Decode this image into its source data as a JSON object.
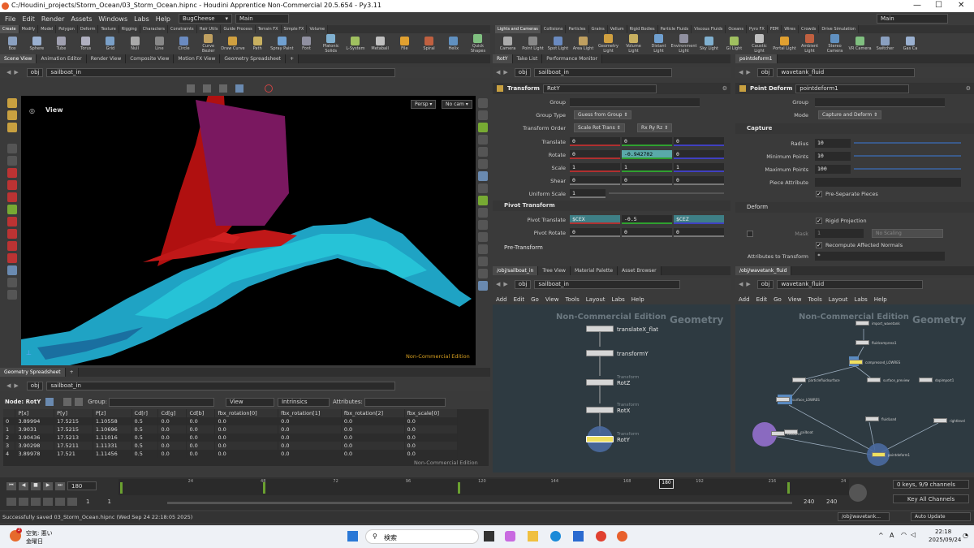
{
  "window": {
    "title": "C:/Houdini_projects/Storm_Ocean/03_Storm_Ocean.hipnc - Houdini Apprentice Non-Commercial 20.5.654 - Py3.11",
    "minimize": "—",
    "maximize": "☐",
    "close": "✕"
  },
  "menu": {
    "items": [
      "File",
      "Edit",
      "Render",
      "Assets",
      "Windows",
      "Labs",
      "Help"
    ],
    "desktop": "BugCheese",
    "context": "Main",
    "right_desktop": "Main"
  },
  "shelf_left": {
    "tabs": [
      "Create",
      "Modify",
      "Model",
      "Polygon",
      "Deform",
      "Texture",
      "Rigging",
      "Characters",
      "Constraints",
      "Hair Utils",
      "Guide Process",
      "Terrain FX",
      "Simple FX",
      "Volume"
    ],
    "tools": [
      "Box",
      "Sphere",
      "Tube",
      "Torus",
      "Grid",
      "Null",
      "Line",
      "Circle",
      "Curve Bezier",
      "Draw Curve",
      "Path",
      "Spray Paint",
      "Font",
      "Platonic Solids",
      "L-System",
      "Metaball",
      "File",
      "Spiral",
      "Helix",
      "Quick Shapes"
    ]
  },
  "shelf_right": {
    "tabs": [
      "Lights and Cameras",
      "Collisions",
      "Particles",
      "Grains",
      "Vellum",
      "Rigid Bodies",
      "Particle Fluids",
      "Viscous Fluids",
      "Oceans",
      "Pyro FX",
      "FEM",
      "Wires",
      "Crowds",
      "Drive Simulation"
    ],
    "tools": [
      "Camera",
      "Point Light",
      "Spot Light",
      "Area Light",
      "Geometry Light",
      "Volume Light",
      "Distant Light",
      "Environment Light",
      "Sky Light",
      "GI Light",
      "Caustic Light",
      "Portal Light",
      "Ambient Light",
      "Stereo Camera",
      "VR Camera",
      "Switcher",
      "Gas Ca"
    ]
  },
  "viewer": {
    "tabs": [
      "Scene View",
      "Animation Editor",
      "Render View",
      "Composite View",
      "Motion FX View",
      "Geometry Spreadsheet"
    ],
    "net": "obj",
    "node": "sailboat_in",
    "label": "View",
    "persp": "Persp ▾",
    "cam": "No cam ▾",
    "watermark": "Non-Commercial Edition"
  },
  "parms": {
    "tabs": [
      "RotY",
      "Take List",
      "Performance Monitor"
    ],
    "net": "obj",
    "node": "sailboat_in",
    "op_type": "Transform",
    "op_name": "RotY",
    "group_label": "Group",
    "group_type_label": "Group Type",
    "group_type": "Guess from Group",
    "order_label": "Transform Order",
    "order": "Scale Rot Trans",
    "rot_order": "Rx Ry Rz",
    "translate_label": "Translate",
    "translate": [
      "0",
      "0",
      "0"
    ],
    "rotate_label": "Rotate",
    "rotate": [
      "0",
      "-0.942702",
      "0"
    ],
    "scale_label": "Scale",
    "scale": [
      "1",
      "1",
      "1"
    ],
    "shear_label": "Shear",
    "shear": [
      "0",
      "0",
      "0"
    ],
    "uscale_label": "Uniform Scale",
    "uscale": "1",
    "pivot_section": "Pivot Transform",
    "pivot_t_label": "Pivot Translate",
    "pivot_t": [
      "$CEX",
      "-0.5",
      "$CEZ"
    ],
    "pivot_r_label": "Pivot Rotate",
    "pivot_r": [
      "0",
      "0",
      "0"
    ],
    "pre_section": "Pre-Transform"
  },
  "parms2": {
    "tab": "pointdeform1",
    "net": "obj",
    "node": "wavetank_fluid",
    "op_type": "Point Deform",
    "op_name": "pointdeform1",
    "group_label": "Group",
    "mode_label": "Mode",
    "mode": "Capture and Deform",
    "capture_section": "Capture",
    "radius_label": "Radius",
    "radius": "10",
    "minpts_label": "Minimum Points",
    "minpts": "10",
    "maxpts_label": "Maximum Points",
    "maxpts": "100",
    "piece_label": "Piece Attribute",
    "presep": "Pre-Separate Pieces",
    "deform_section": "Deform",
    "rigid": "Rigid Projection",
    "mask_label": "Mask",
    "mask": "1",
    "noscale": "No Scaling",
    "recompute": "Recompute Affected Normals",
    "attrs_label": "Attributes to Transform",
    "attrs": "*"
  },
  "spreadsheet": {
    "tab": "Geometry Spreadsheet",
    "net": "obj",
    "node": "sailboat_in",
    "node_label": "Node: RotY",
    "group_label": "Group:",
    "view": "View",
    "intrinsics": "Intrinsics",
    "attributes": "Attributes:",
    "columns": [
      "",
      "P[x]",
      "P[y]",
      "P[z]",
      "Cd[r]",
      "Cd[g]",
      "Cd[b]",
      "fbx_rotation[0]",
      "fbx_rotation[1]",
      "fbx_rotation[2]",
      "fbx_scale[0]"
    ],
    "rows": [
      [
        "0",
        "3.89994",
        "17.5215",
        "1.10558",
        "0.5",
        "0.0",
        "0.0",
        "0.0",
        "0.0",
        "0.0",
        "0.0"
      ],
      [
        "1",
        "3.9031",
        "17.5215",
        "1.10696",
        "0.5",
        "0.0",
        "0.0",
        "0.0",
        "0.0",
        "0.0",
        "0.0"
      ],
      [
        "2",
        "3.90436",
        "17.5213",
        "1.11016",
        "0.5",
        "0.0",
        "0.0",
        "0.0",
        "0.0",
        "0.0",
        "0.0"
      ],
      [
        "3",
        "3.90298",
        "17.5211",
        "1.11331",
        "0.5",
        "0.0",
        "0.0",
        "0.0",
        "0.0",
        "0.0",
        "0.0"
      ],
      [
        "4",
        "3.89978",
        "17.521",
        "1.11456",
        "0.5",
        "0.0",
        "0.0",
        "0.0",
        "0.0",
        "0.0",
        "0.0"
      ]
    ],
    "watermark": "Non-Commercial Edition"
  },
  "net1": {
    "tabs": [
      "/obj/sailboat_in",
      "Tree View",
      "Material Palette",
      "Asset Browser"
    ],
    "net": "obj",
    "node": "sailboat_in",
    "menu": [
      "Add",
      "Edit",
      "Go",
      "View",
      "Tools",
      "Layout",
      "Labs",
      "Help"
    ],
    "wm1": "Non-Commercial Edition",
    "wm2": "Geometry",
    "nodes": [
      {
        "type": "",
        "name": "translateX_flat"
      },
      {
        "type": "",
        "name": "transformY"
      },
      {
        "type": "Transform",
        "name": "RotZ"
      },
      {
        "type": "Transform",
        "name": "RotX"
      },
      {
        "type": "Transform",
        "name": "RotY"
      }
    ]
  },
  "net2": {
    "tab": "/obj/wavetank_fluid",
    "net": "obj",
    "node": "wavetank_fluid",
    "menu": [
      "Add",
      "Edit",
      "Go",
      "View",
      "Tools",
      "Layout",
      "Labs",
      "Help"
    ],
    "wm1": "Non-Commercial Edition",
    "wm2": "Geometry",
    "nodes": [
      "import_wavetank",
      "fluidcompress1",
      "compressed_LOWRES",
      "particlefluidsurface",
      "surface_preview",
      "dopimport1",
      "surface_LOWRES",
      "fluidLoad",
      "sailboat",
      "rightlevel",
      "pointdeform1",
      "resource"
    ]
  },
  "timeline": {
    "frame": "180",
    "ticks": [
      "24",
      "48",
      "72",
      "96",
      "120",
      "144",
      "168",
      "180",
      "192",
      "216",
      "24"
    ],
    "start": "1",
    "start2": "1",
    "end": "240",
    "end2": "240",
    "keys": "0 keys, 9/9 channels",
    "key_all": "Key All Channels",
    "path": "/obj/wavetank...",
    "auto": "Auto Update"
  },
  "status": {
    "message": "Successfully saved 03_Storm_Ocean.hipnc (Wed Sep 24 22:18:05 2025)"
  },
  "taskbar": {
    "weather": "空気: 悪い",
    "day": "金曜日",
    "search": "検索",
    "ime": "A",
    "time": "22:18",
    "date": "2025/09/24",
    "badge": "2"
  }
}
